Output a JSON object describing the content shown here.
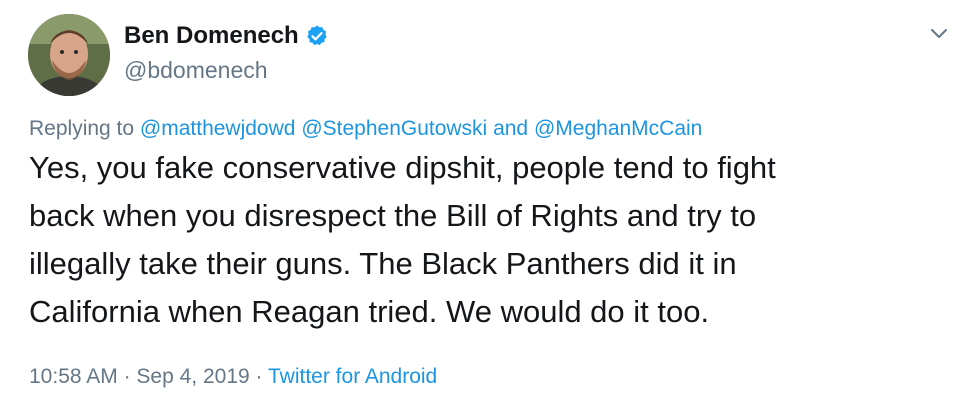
{
  "author": {
    "display_name": "Ben Domenech",
    "handle": "@bdomenech",
    "verified": true
  },
  "reply": {
    "prefix": "Replying to",
    "mention_1": "@matthewjdowd",
    "mention_2": "@StephenGutowski",
    "conjunction": "and",
    "mention_3": "@MeghanMcCain"
  },
  "body_lines": [
    "Yes, you fake conservative dipshit, people tend to fight",
    "back when you disrespect the Bill of Rights and try to",
    "illegally take their guns. The Black Panthers did it in",
    "California when Reagan tried. We would do it too."
  ],
  "meta": {
    "time": "10:58 AM",
    "date": "Sep 4, 2019",
    "separator": "·",
    "source": "Twitter for Android"
  },
  "colors": {
    "link": "#1b95e0",
    "secondary_text": "#657786",
    "primary_text": "#14171a",
    "verified": "#1da1f2"
  },
  "icons": {
    "verified": "verified-badge-icon",
    "menu": "chevron-down-icon"
  }
}
